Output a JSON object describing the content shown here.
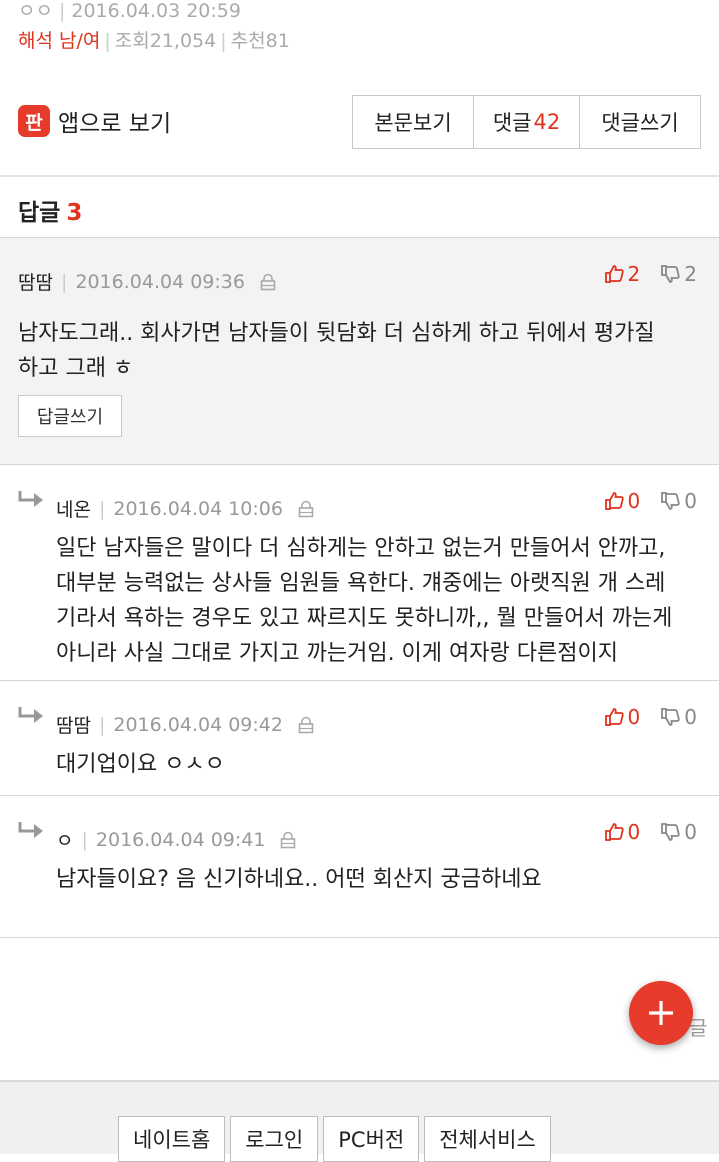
{
  "post_meta": {
    "mark": "ㅇㅇ",
    "datetime": "2016.04.03 20:59",
    "category": "해석 남/여",
    "views_label": "조회",
    "views": "21,054",
    "recommend_label": "추천",
    "recommend": "81"
  },
  "app_link": {
    "logo_text": "판",
    "label": "앱으로 보기"
  },
  "nav_buttons": {
    "body_view": "본문보기",
    "comments_label": "댓글",
    "comments_count": "42",
    "write_comment": "댓글쓰기"
  },
  "replies_section": {
    "title": "답글",
    "count": "3"
  },
  "main_comment": {
    "author": "땀땀",
    "datetime": "2016.04.04 09:36",
    "body": "남자도그래.. 회사가면 남자들이 뒷담화 더 심하게 하고 뒤에서 평가질\n하고 그래 ㅎ",
    "up": "2",
    "down": "2",
    "reply_button": "답글쓰기"
  },
  "replies": [
    {
      "author": "네온",
      "datetime": "2016.04.04 10:06",
      "body": "일단 남자들은 말이다 더 심하게는 안하고 없는거 만들어서 안까고,\n대부분 능력없는 상사들 임원들 욕한다. 걔중에는 아랫직원 개 스레\n기라서 욕하는 경우도 있고 짜르지도 못하니까,, 뭘 만들어서 까는게\n아니라 사실 그대로 가지고 까는거임. 이게 여자랑 다른점이지",
      "up": "0",
      "down": "0"
    },
    {
      "author": "땀땀",
      "datetime": "2016.04.04 09:42",
      "body": "대기업이요 ㅇㅅㅇ",
      "up": "0",
      "down": "0"
    },
    {
      "author": "ㅇ",
      "datetime": "2016.04.04 09:41",
      "body": "남자들이요? 음 신기하네요.. 어떤 회산지 궁금하네요",
      "up": "0",
      "down": "0"
    }
  ],
  "fab": {
    "icon": "plus-icon",
    "peek_text": "글"
  },
  "footer": {
    "links": [
      "네이트홈",
      "로그인",
      "PC버전",
      "전체서비스"
    ]
  },
  "colors": {
    "accent": "#e63a2a",
    "highlight": "#e0321d",
    "gray_bg": "#f3f3f3"
  }
}
